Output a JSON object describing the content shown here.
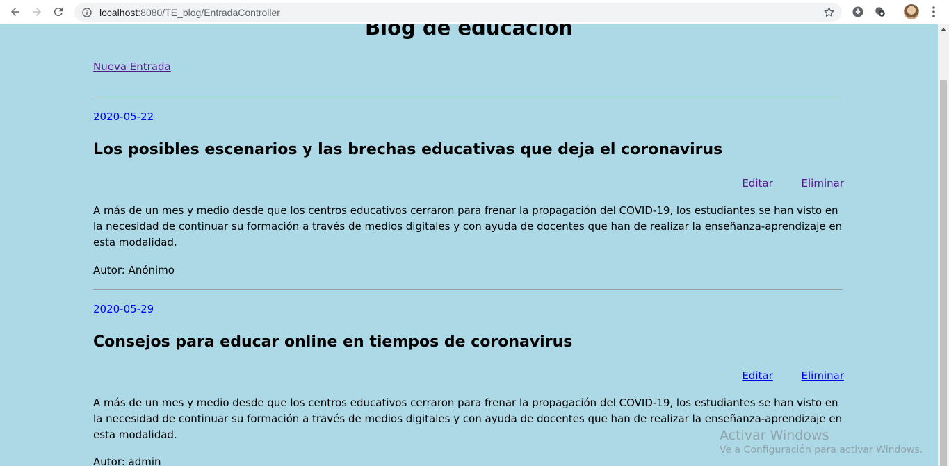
{
  "browser": {
    "url_host": "localhost",
    "url_path": ":8080/TE_blog/EntradaController"
  },
  "page": {
    "title": "Blog de educación",
    "new_entry_link": "Nueva Entrada"
  },
  "entries": [
    {
      "date": "2020-05-22",
      "title": "Los posibles escenarios y las brechas educativas que deja el coronavirus",
      "edit_label": "Editar",
      "delete_label": "Eliminar",
      "body": "A más de un mes y medio desde que los centros educativos cerraron para frenar la propagación del COVID-19, los estudiantes se han visto en la necesidad de continuar su formación a través de medios digitales y con ayuda de docentes que han de realizar la enseñanza-aprendizaje en esta modalidad.",
      "author": "Autor: Anónimo",
      "edit_color": "#551a8b",
      "delete_color": "#551a8b"
    },
    {
      "date": "2020-05-29",
      "title": "Consejos para educar online en tiempos de coronavirus",
      "edit_label": "Editar",
      "delete_label": "Eliminar",
      "body": "A más de un mes y medio desde que los centros educativos cerraron para frenar la propagación del COVID-19, los estudiantes se han visto en la necesidad de continuar su formación a través de medios digitales y con ayuda de docentes que han de realizar la enseñanza-aprendizaje en esta modalidad.",
      "author": "Autor: admin",
      "edit_color": "#0000ee",
      "delete_color": "#0000ee"
    }
  ],
  "watermark": {
    "line1": "Activar Windows",
    "line2": "Ve a Configuración para activar Windows."
  },
  "colors": {
    "background": "#add8e6",
    "date": "#0000ff",
    "visited_link": "#551a8b",
    "link": "#0000ee"
  },
  "icons": [
    "back-arrow-icon",
    "forward-arrow-icon",
    "reload-icon",
    "info-icon",
    "star-icon",
    "download-icon",
    "extension-icon",
    "avatar",
    "menu-dots-icon"
  ]
}
